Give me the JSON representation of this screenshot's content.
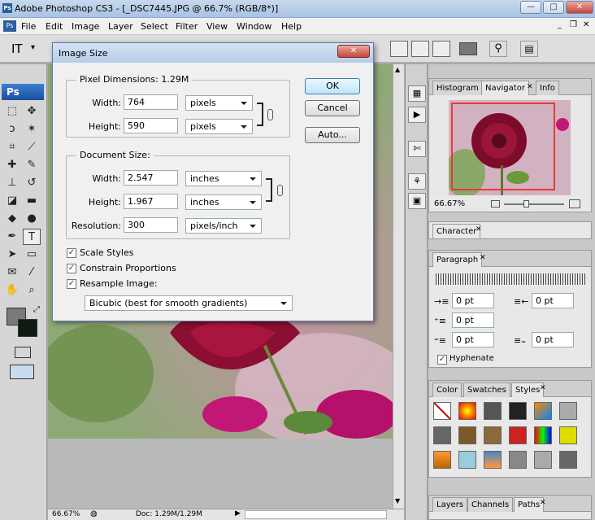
{
  "app": {
    "title": "Adobe Photoshop CS3 - [_DSC7445.JPG @ 66.7% (RGB/8*)]",
    "min_label": "—",
    "max_label": "□",
    "close_label": "✕",
    "doc_min_label": "_",
    "doc_max_label": "❐",
    "doc_close_label": "✕"
  },
  "menu": [
    "File",
    "Edit",
    "Image",
    "Layer",
    "Select",
    "Filter",
    "View",
    "Window",
    "Help"
  ],
  "ps_badge": "Ps",
  "options_bar": {
    "tool_glyph": "ⅠT",
    "tool_arrow": "▾"
  },
  "dialog": {
    "title": "Image Size",
    "pixel_dimensions_label": "Pixel Dimensions:",
    "pixel_dimensions_value": "1.29M",
    "width_label": "Width:",
    "height_label": "Height:",
    "pixel_width": "764",
    "pixel_height": "590",
    "pixel_unit_w": "pixels",
    "pixel_unit_h": "pixels",
    "document_size_label": "Document Size:",
    "doc_width": "2.547",
    "doc_height": "1.967",
    "doc_unit_w": "inches",
    "doc_unit_h": "inches",
    "resolution_label": "Resolution:",
    "resolution": "300",
    "resolution_unit": "pixels/inch",
    "scale_styles": "Scale Styles",
    "constrain": "Constrain Proportions",
    "resample": "Resample Image:",
    "resample_method": "Bicubic (best for smooth gradients)",
    "ok": "OK",
    "cancel": "Cancel",
    "auto": "Auto...",
    "checked_glyph": "✓"
  },
  "navigator": {
    "tabs": [
      "Histogram",
      "Navigator",
      "Info"
    ],
    "zoom": "66.67%"
  },
  "character": {
    "tab": "Character"
  },
  "paragraph": {
    "tab": "Paragraph",
    "indent_left": "0 pt",
    "indent_right": "0 pt",
    "indent_first": "0 pt",
    "space_before": "0 pt",
    "space_after": "0 pt",
    "hyphenate": "Hyphenate"
  },
  "styles": {
    "tabs": [
      "Color",
      "Swatches",
      "Styles"
    ]
  },
  "layers": {
    "tabs": [
      "Layers",
      "Channels",
      "Paths"
    ]
  },
  "status": {
    "zoom": "66.67%",
    "doc": "Doc: 1.29M/1.29M"
  },
  "colors": {
    "foreground": "#7a7a7a",
    "background": "#0e1a12",
    "accent": "#3c7fb1"
  }
}
